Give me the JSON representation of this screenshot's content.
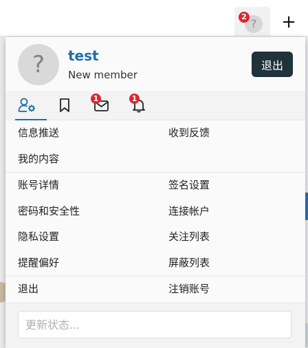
{
  "topbar": {
    "notification_count": "2",
    "avatar_glyph": "?",
    "plus_glyph": "+"
  },
  "user": {
    "avatar_glyph": "?",
    "name": "test",
    "title": "New member",
    "logout_label": "退出"
  },
  "tabs": [
    {
      "icon": "user-cog-icon",
      "active": true,
      "badge": ""
    },
    {
      "icon": "bookmark-icon",
      "active": false,
      "badge": ""
    },
    {
      "icon": "envelope-icon",
      "active": false,
      "badge": "1"
    },
    {
      "icon": "bell-icon",
      "active": false,
      "badge": "1"
    }
  ],
  "menu": {
    "push_notifications": "信息推送",
    "feedback_received": "收到反馈",
    "my_content": "我的内容",
    "account_details": "账号详情",
    "signature_settings": "签名设置",
    "password_security": "密码和安全性",
    "connected_accounts": "连接帐户",
    "privacy_settings": "隐私设置",
    "follow_list": "关注列表",
    "reminder_preferences": "提醒偏好",
    "block_list": "屏蔽列表",
    "logout": "退出",
    "delete_account": "注销账号"
  },
  "status": {
    "placeholder": "更新状态..."
  },
  "colors": {
    "accent": "#1f6fa6",
    "logout_button": "#20323a",
    "badge": "#e0262f"
  }
}
